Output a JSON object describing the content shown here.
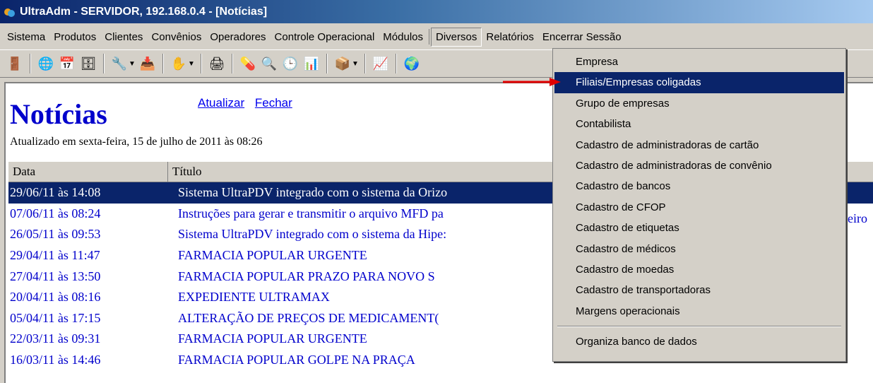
{
  "window": {
    "title": "UltraAdm - SERVIDOR, 192.168.0.4 - [Notícias]"
  },
  "menubar": [
    "Sistema",
    "Produtos",
    "Clientes",
    "Convênios",
    "Operadores",
    "Controle Operacional",
    "Módulos",
    "Diversos",
    "Relatórios",
    "Encerrar Sessão"
  ],
  "news": {
    "heading": "Notícias",
    "refresh_link": "Atualizar",
    "close_link": "Fechar",
    "updated": "Atualizado em sexta-feira, 15 de julho de 2011 às 08:26",
    "columns": {
      "date": "Data",
      "title": "Título"
    },
    "rows": [
      {
        "date": "29/06/11 às 14:08",
        "title": "Sistema UltraPDV integrado com o sistema da Orizo"
      },
      {
        "date": "07/06/11 às 08:24",
        "title": "Instruções para gerar e transmitir o arquivo MFD pa"
      },
      {
        "date": "26/05/11 às 09:53",
        "title": "Sistema UltraPDV integrado com o sistema da Hipe:"
      },
      {
        "date": "29/04/11 às 11:47",
        "title": "FARMACIA POPULAR URGENTE"
      },
      {
        "date": "27/04/11 às 13:50",
        "title": "FARMACIA POPULAR PRAZO PARA NOVO S"
      },
      {
        "date": "20/04/11 às 08:16",
        "title": "EXPEDIENTE ULTRAMAX"
      },
      {
        "date": "05/04/11 às 17:15",
        "title": "ALTERAÇÃO DE PREÇOS DE MEDICAMENT("
      },
      {
        "date": "22/03/11 às 09:31",
        "title": "FARMACIA POPULAR URGENTE"
      },
      {
        "date": "16/03/11 às 14:46",
        "title": "FARMACIA POPULAR GOLPE NA PRAÇA"
      }
    ],
    "overflow_text": "eiro"
  },
  "dropdown": {
    "items": [
      "Empresa",
      "Filiais/Empresas coligadas",
      "Grupo de empresas",
      "Contabilista",
      "Cadastro de administradoras de cartão",
      "Cadastro de administradoras de convênio",
      "Cadastro de bancos",
      "Cadastro de CFOP",
      "Cadastro de etiquetas",
      "Cadastro de médicos",
      "Cadastro de moedas",
      "Cadastro de transportadoras",
      "Margens operacionais"
    ],
    "footer_item": "Organiza banco de dados",
    "highlighted_index": 1
  },
  "colors": {
    "selection": "#0a246a",
    "link": "#0000cc",
    "arrow": "#e00000"
  }
}
